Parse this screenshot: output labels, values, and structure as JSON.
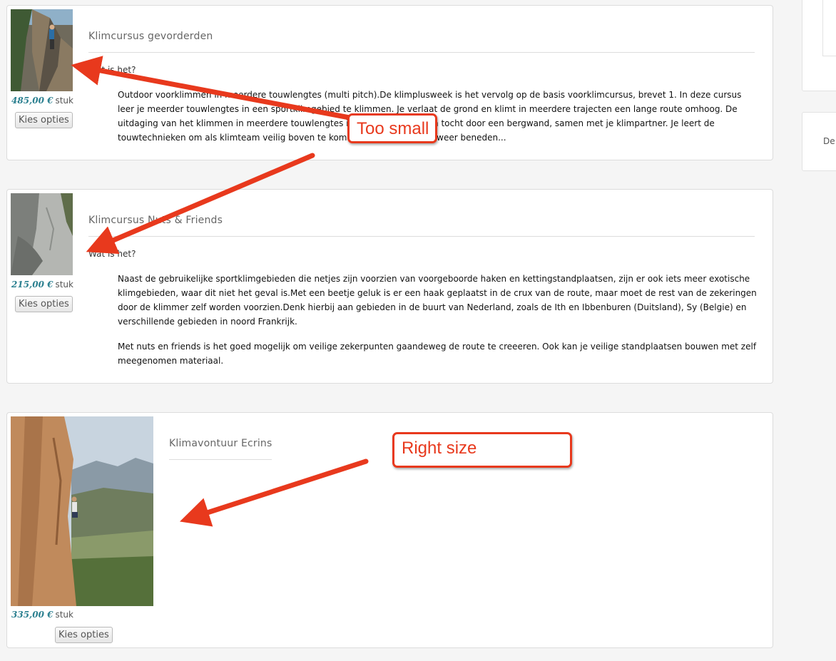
{
  "products": [
    {
      "title": "Klimcursus gevorderden",
      "price": "485,00 €",
      "unit": "stuk",
      "button": "Kies opties",
      "wat_is_het": "Wat is het?",
      "paragraphs": [
        "Outdoor voorklimmen in meerdere touwlengtes (multi pitch).De klimplusweek is het vervolg op de basis voorklimcursus, brevet 1. In deze cursus leer je meerder touwlengtes in een sportklimgebied te klimmen. Je verlaat de grond en klimt in meerdere trajecten een lange route omhoog. De uitdaging van het klimmen in meerdere touwlengtes is het maken van een tocht door een bergwand, samen met je klimpartner. Je leert de touwtechnieken om als klimteam veilig boven te komen, en uiteraard ook weer beneden..."
      ]
    },
    {
      "title": "Klimcursus Nuts & Friends",
      "price": "215,00 €",
      "unit": "stuk",
      "button": "Kies opties",
      "wat_is_het": "Wat is het?",
      "paragraphs": [
        "Naast de gebruikelijke sportklimgebieden die netjes zijn voorzien van voorgeboorde haken en kettingstandplaatsen, zijn er ook iets meer exotische klimgebieden, waar dit niet het geval is.Met een beetje geluk is er een haak geplaatst in de crux van de route, maar moet de rest van de zekeringen door de klimmer zelf worden voorzien.Denk hierbij aan gebieden in de buurt van Nederland, zoals de Ith en Ibbenburen (Duitsland), Sy (Belgie) en verschillende gebieden in noord Frankrijk.",
        "Met nuts en friends is het goed mogelijk om veilige zekerpunten gaandeweg de route te creeeren. Ook kan je veilige standplaatsen bouwen met zelf meegenomen materiaal."
      ]
    },
    {
      "title": "Klimavontuur Ecrins",
      "price": "335,00 €",
      "unit": "stuk",
      "button": "Kies opties"
    }
  ],
  "sidebar": {
    "snippet": "De"
  },
  "annotations": {
    "too_small": "Too small",
    "right_size": "Right size"
  },
  "colors": {
    "price": "#2a7f8f",
    "annotation": "#e8391d",
    "card_border": "#dcdcdc"
  },
  "icons": [
    "climber-photo-1",
    "climber-photo-2",
    "climber-photo-3",
    "annotation-arrow"
  ]
}
